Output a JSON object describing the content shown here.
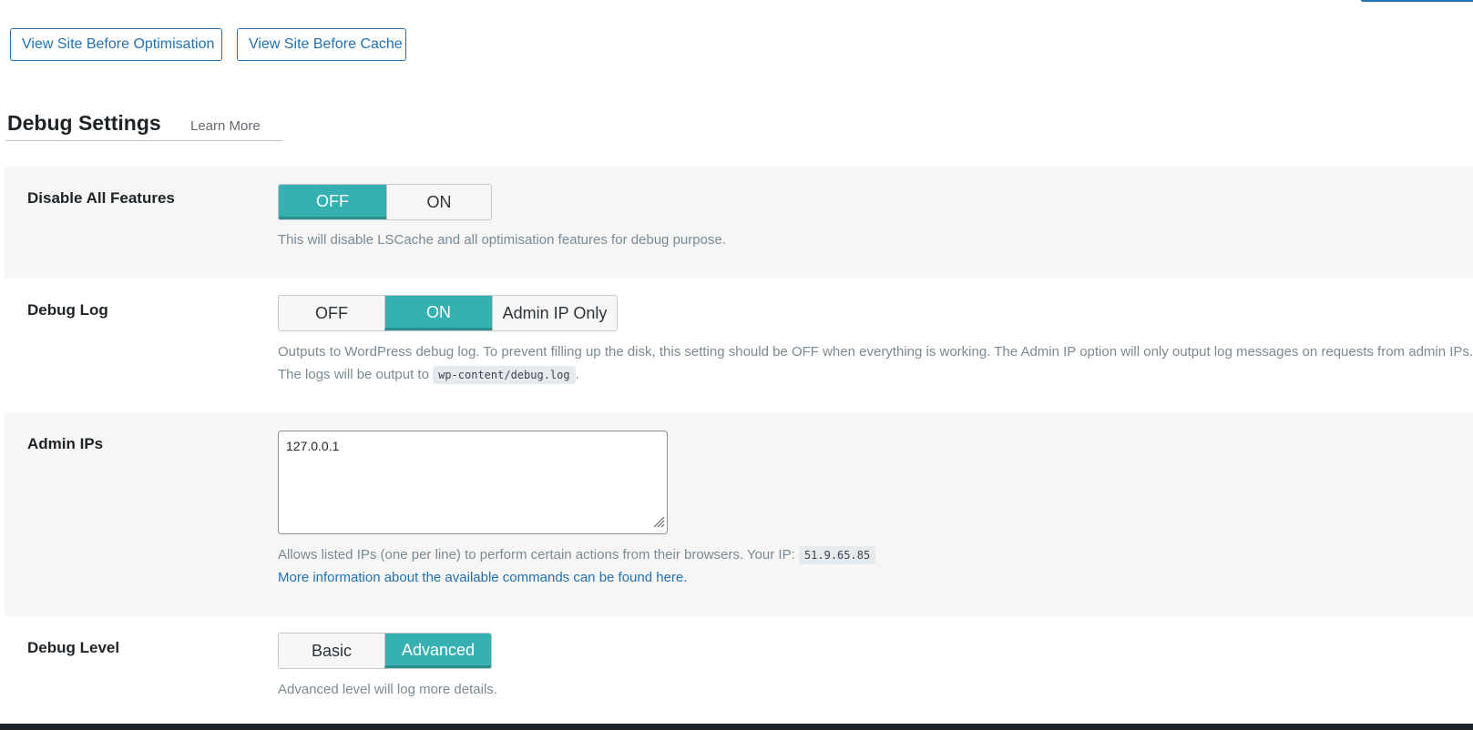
{
  "top_buttons": {
    "view_before_optimisation": "View Site Before Optimisation",
    "view_before_cache": "View Site Before Cache"
  },
  "section": {
    "title": "Debug Settings",
    "learn_more": "Learn More"
  },
  "disable_all": {
    "label": "Disable All Features",
    "options": [
      "OFF",
      "ON"
    ],
    "selected": "OFF",
    "description": "This will disable LSCache and all optimisation features for debug purpose."
  },
  "debug_log": {
    "label": "Debug Log",
    "options": [
      "OFF",
      "ON",
      "Admin IP Only"
    ],
    "selected": "ON",
    "description_line1": "Outputs to WordPress debug log. To prevent filling up the disk, this setting should be OFF when everything is working. The Admin IP option will only output log messages on requests from admin IPs.",
    "description_line2_prefix": "The logs will be output to",
    "log_path": "wp-content/debug.log",
    "description_line2_suffix": "."
  },
  "admin_ips": {
    "label": "Admin IPs",
    "value": "127.0.0.1",
    "description_prefix": "Allows listed IPs (one per line) to perform certain actions from their browsers. Your IP:",
    "your_ip": "51.9.65.85",
    "more_info_link": "More information about the available commands can be found here."
  },
  "debug_level": {
    "label": "Debug Level",
    "options": [
      "Basic",
      "Advanced"
    ],
    "selected": "Advanced",
    "description": "Advanced level will log more details."
  },
  "colors": {
    "accent_teal": "#36b0b0",
    "link_blue": "#2271b1",
    "row_shade": "#f5f6f5"
  }
}
